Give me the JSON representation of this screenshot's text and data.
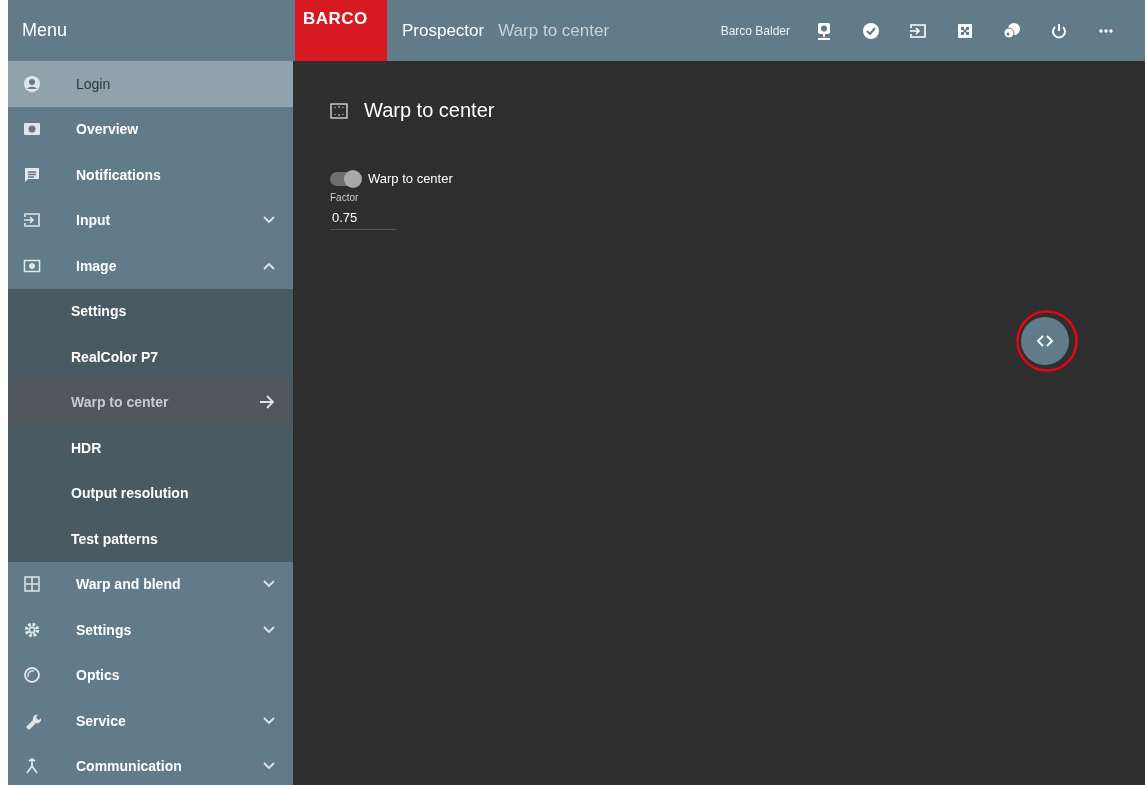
{
  "menu": {
    "title": "Menu",
    "items": [
      {
        "kind": "link",
        "label": "Login",
        "selected": true
      },
      {
        "kind": "link",
        "label": "Overview",
        "selected": false
      },
      {
        "kind": "link",
        "label": "Notifications",
        "selected": false
      },
      {
        "kind": "group",
        "label": "Input",
        "selected": false,
        "expanded": false
      },
      {
        "kind": "group",
        "label": "Image",
        "selected": false,
        "expanded": true,
        "children": [
          {
            "label": "Settings",
            "selected": false
          },
          {
            "label": "RealColor P7",
            "selected": false
          },
          {
            "label": "Warp to center",
            "selected": true
          },
          {
            "label": "HDR",
            "selected": false
          },
          {
            "label": "Output resolution",
            "selected": false
          },
          {
            "label": "Test patterns",
            "selected": false
          }
        ]
      },
      {
        "kind": "group",
        "label": "Warp and blend",
        "selected": false,
        "expanded": false
      },
      {
        "kind": "group",
        "label": "Settings",
        "selected": false,
        "expanded": false
      },
      {
        "kind": "link",
        "label": "Optics",
        "selected": false
      },
      {
        "kind": "group",
        "label": "Service",
        "selected": false,
        "expanded": false
      },
      {
        "kind": "group",
        "label": "Communication",
        "selected": false,
        "expanded": false
      }
    ]
  },
  "topbar": {
    "logo": "BARCO",
    "app_title": "Prospector",
    "page_title": "Warp to center",
    "user": "Barco Balder"
  },
  "content": {
    "title": "Warp to center",
    "toggle": {
      "label": "Warp to center",
      "on": true
    },
    "field": {
      "label": "Factor",
      "value": "0.75"
    },
    "fab": {
      "highlighted": true
    }
  }
}
